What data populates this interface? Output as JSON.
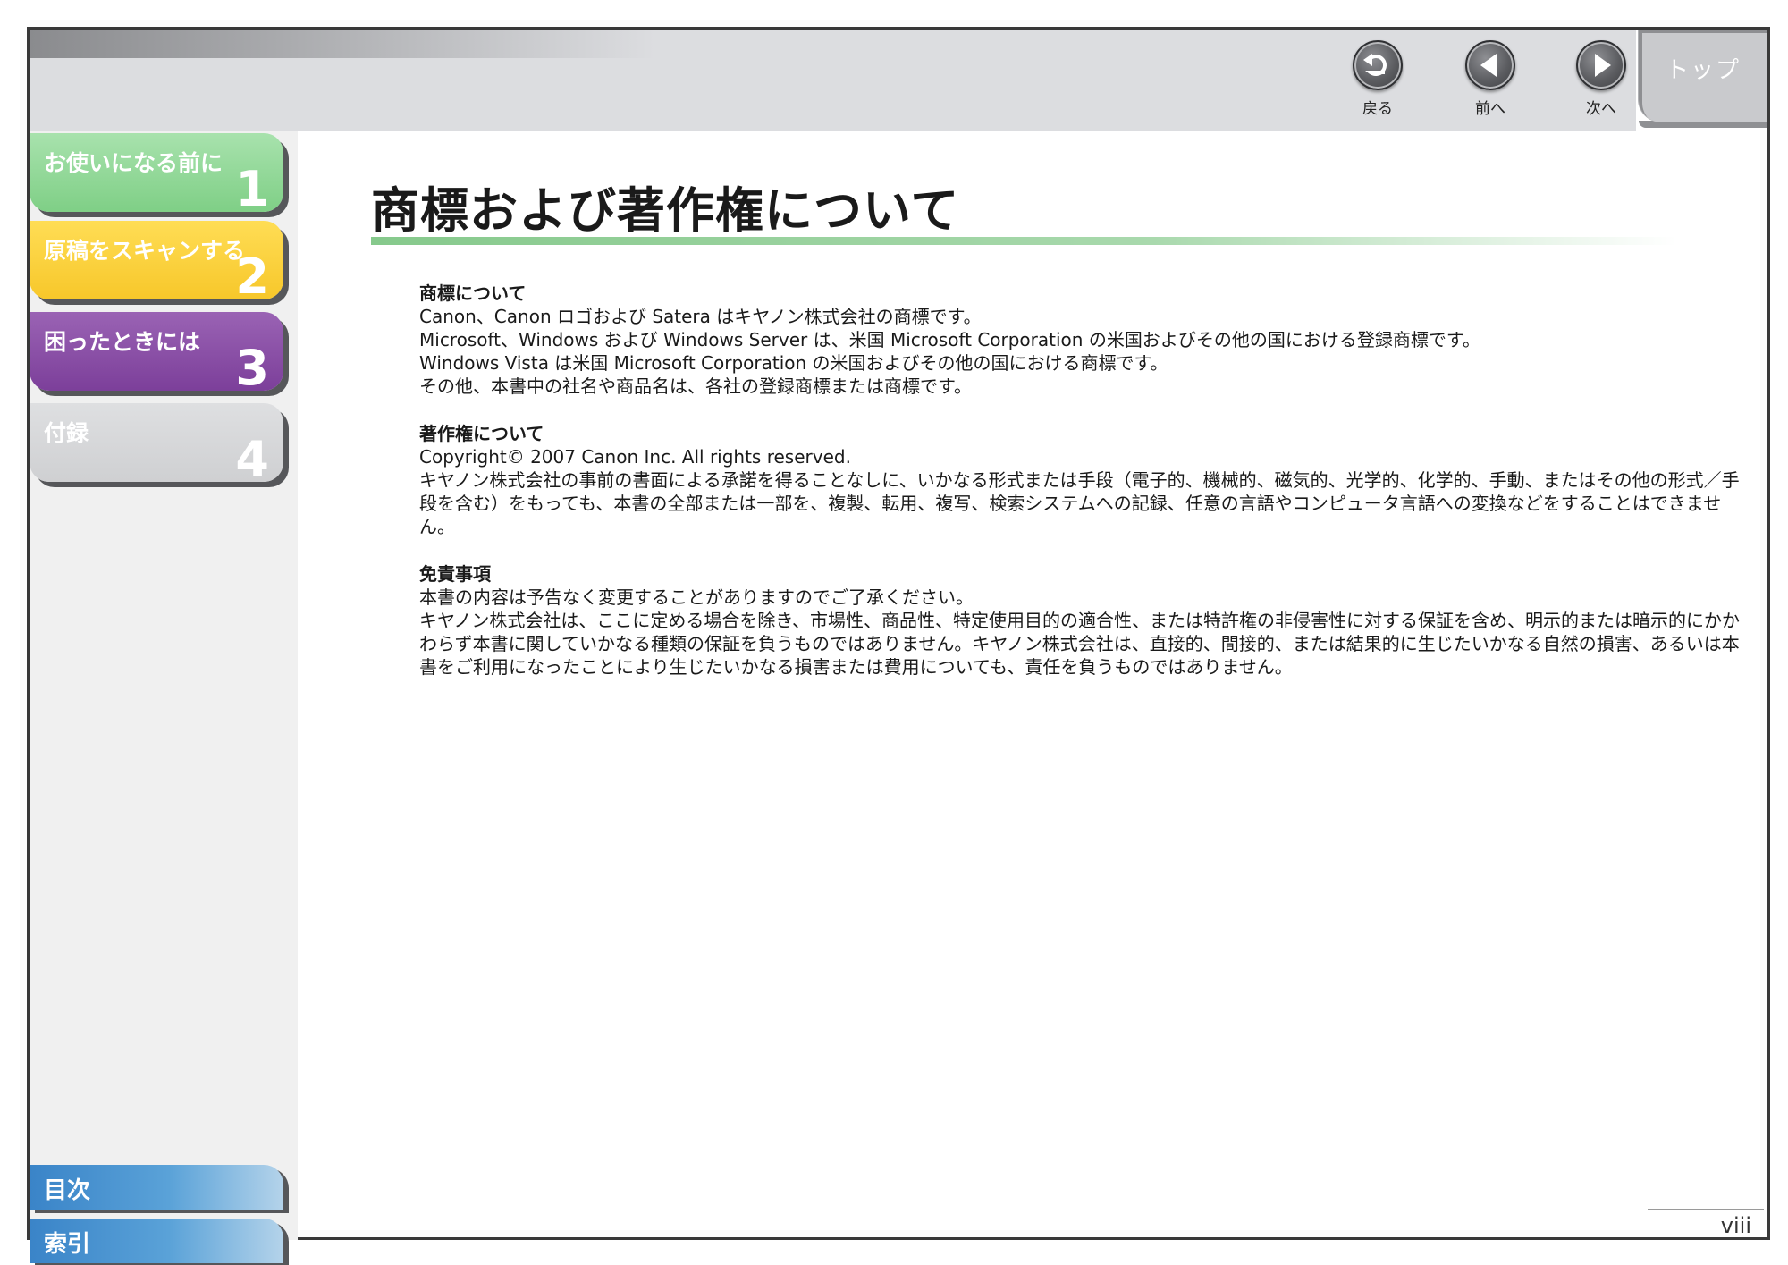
{
  "toolbar": {
    "back_label": "戻る",
    "prev_label": "前へ",
    "next_label": "次へ",
    "top_label": "トップ"
  },
  "sidebar": {
    "chapters": [
      {
        "label": "お使いになる前に",
        "number": "1",
        "color": "#7fcf86"
      },
      {
        "label": "原稿をスキャンする",
        "number": "2",
        "color": "#f7c72a"
      },
      {
        "label": "困ったときには",
        "number": "3",
        "color": "#7c3f9a"
      },
      {
        "label": "付録",
        "number": "4",
        "color": "#cfd0d2"
      }
    ],
    "contents_label": "目次",
    "index_label": "索引"
  },
  "main": {
    "title": "商標および著作権について",
    "sections": [
      {
        "heading": "商標について",
        "lines": [
          "Canon、Canon ロゴおよび Satera はキヤノン株式会社の商標です。",
          "Microsoft、Windows および Windows Server は、米国 Microsoft Corporation の米国およびその他の国における登録商標です。",
          "Windows Vista は米国 Microsoft Corporation の米国およびその他の国における商標です。",
          "その他、本書中の社名や商品名は、各社の登録商標または商標です。"
        ]
      },
      {
        "heading": "著作権について",
        "lines": [
          "Copyright© 2007 Canon Inc. All rights reserved.",
          "キヤノン株式会社の事前の書面による承諾を得ることなしに、いかなる形式または手段（電子的、機械的、磁気的、光学的、化学的、手動、またはその他の形式／手段を含む）をもっても、本書の全部または一部を、複製、転用、複写、検索システムへの記録、任意の言語やコンピュータ言語への変換などをすることはできません。"
        ]
      },
      {
        "heading": "免責事項",
        "lines": [
          "本書の内容は予告なく変更することがありますのでご了承ください。",
          "キヤノン株式会社は、ここに定める場合を除き、市場性、商品性、特定使用目的の適合性、または特許権の非侵害性に対する保証を含め、明示的または暗示的にかかわらず本書に関していかなる種類の保証を負うものではありません。キヤノン株式会社は、直接的、間接的、または結果的に生じたいかなる自然の損害、あるいは本書をご利用になったことにより生じたいかなる損害または費用についても、責任を負うものではありません。"
        ]
      }
    ],
    "page_number": "viii"
  }
}
